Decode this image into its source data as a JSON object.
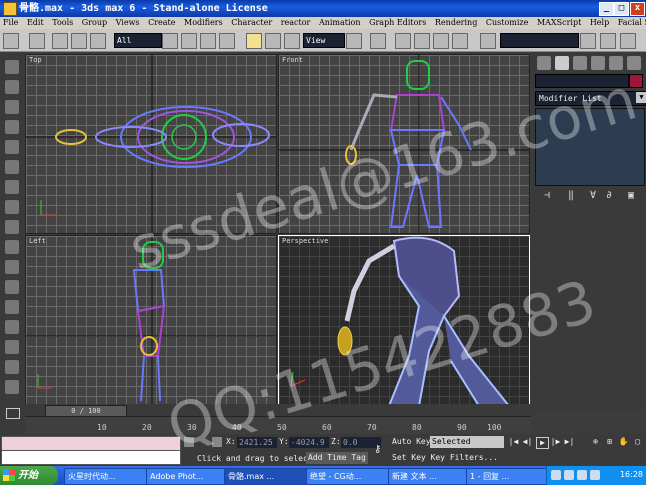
{
  "window": {
    "title": "骨骼.max - 3ds max 6 - Stand-alone License",
    "min": "_",
    "max": "□",
    "close": "x"
  },
  "menu": [
    "File",
    "Edit",
    "Tools",
    "Group",
    "Views",
    "Create",
    "Modifiers",
    "Character",
    "reactor",
    "Animation",
    "Graph Editors",
    "Rendering",
    "Customize",
    "MAXScript",
    "Help",
    "Facial Studio"
  ],
  "toolbar": {
    "selection_filter": "All",
    "ref_coord": "View",
    "named_selection": ""
  },
  "viewports": {
    "top": "Top",
    "front": "Front",
    "left": "Left",
    "perspective": "Perspective"
  },
  "command_panel": {
    "modifier_list": "Modifier List"
  },
  "timeline": {
    "slider": "0 / 100",
    "ticks": [
      "10",
      "20",
      "30",
      "40",
      "50",
      "60",
      "70",
      "80",
      "90",
      "100"
    ]
  },
  "status": {
    "x_label": "X:",
    "x_value": "2421.25",
    "y_label": "Y:",
    "y_value": "-4024.9",
    "z_label": "Z:",
    "z_value": "0.0",
    "prompt": "Click and drag to select",
    "add_time_tag": "Add Time Tag",
    "auto_key": "Auto Key",
    "key_mode": "Selected",
    "set_key": "Set Key",
    "key_filters": "Key Filters..."
  },
  "taskbar": {
    "start": "开始",
    "tasks": [
      "火星时代动...",
      "Adobe Phot...",
      "骨骼.max ...",
      "绝望 - CG动...",
      "新建 文本 ...",
      "1 - 回复 ..."
    ],
    "clock": "16:28"
  },
  "watermark": {
    "line1": "sssdeal@163.com",
    "line2": "QQ:115422883"
  },
  "colors": {
    "title_bar": "#0a3aa8",
    "viewport_bg": "#434343",
    "selection_color": "#a0163a",
    "taskbar": "#245bd4",
    "start_button": "#2d8b2d"
  }
}
